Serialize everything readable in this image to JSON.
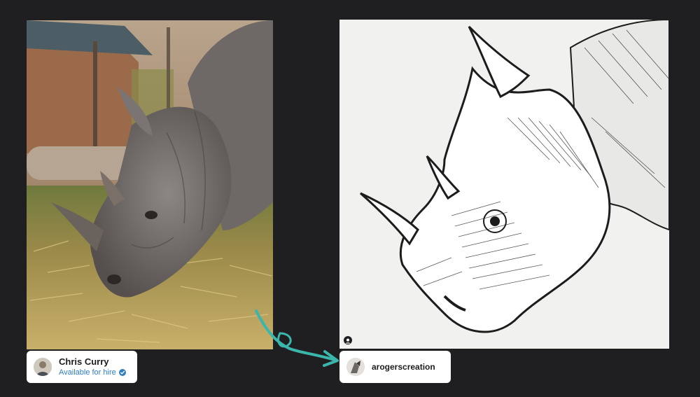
{
  "original_photo": {
    "alt": "Photograph of a rhinoceros grazing on hay"
  },
  "sketch": {
    "alt": "Ink line drawing of a rhinoceros head"
  },
  "photographer_card": {
    "name": "Chris Curry",
    "status": "Available for hire",
    "status_icon": "verified-check-icon",
    "status_color": "#2f7dc1"
  },
  "artist_card": {
    "handle": "arogerscreation"
  },
  "colors": {
    "background": "#1f1f21",
    "arrow": "#3bb6ad"
  }
}
